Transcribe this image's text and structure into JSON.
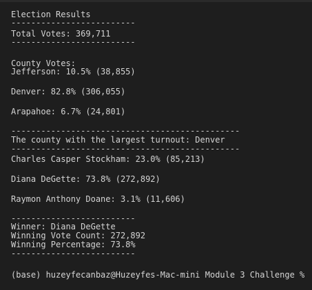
{
  "output": {
    "title": "Election Results",
    "sep_short": "-------------------------",
    "total_votes": "Total Votes: 369,711",
    "county_header": "County Votes:",
    "counties": [
      "Jefferson: 10.5% (38,855)",
      "Denver: 82.8% (306,055)",
      "Arapahoe: 6.7% (24,801)"
    ],
    "sep_long": "----------------------------------------------",
    "largest_turnout": "The county with the largest turnout: Denver",
    "candidates": [
      "Charles Casper Stockham: 23.0% (85,213)",
      "Diana DeGette: 73.8% (272,892)",
      "Raymon Anthony Doane: 3.1% (11,606)"
    ],
    "winner": "Winner: Diana DeGette",
    "winning_count": "Winning Vote Count: 272,892",
    "winning_percentage": "Winning Percentage: 73.8%"
  },
  "prompt": {
    "text": "(base) huzeyfecanbaz@Huzeyfes-Mac-mini Module 3 Challenge %"
  }
}
